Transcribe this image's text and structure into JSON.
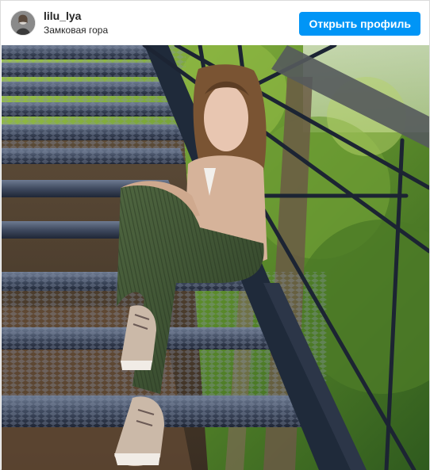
{
  "header": {
    "username": "lilu_lya",
    "location": "Замковая гора",
    "open_profile_label": "Открыть профиль",
    "avatar_icon": "avatar-icon"
  },
  "post": {
    "image_icon": "post-photo"
  },
  "colors": {
    "button_bg": "#0095f6",
    "button_text": "#ffffff",
    "text": "#262626"
  }
}
